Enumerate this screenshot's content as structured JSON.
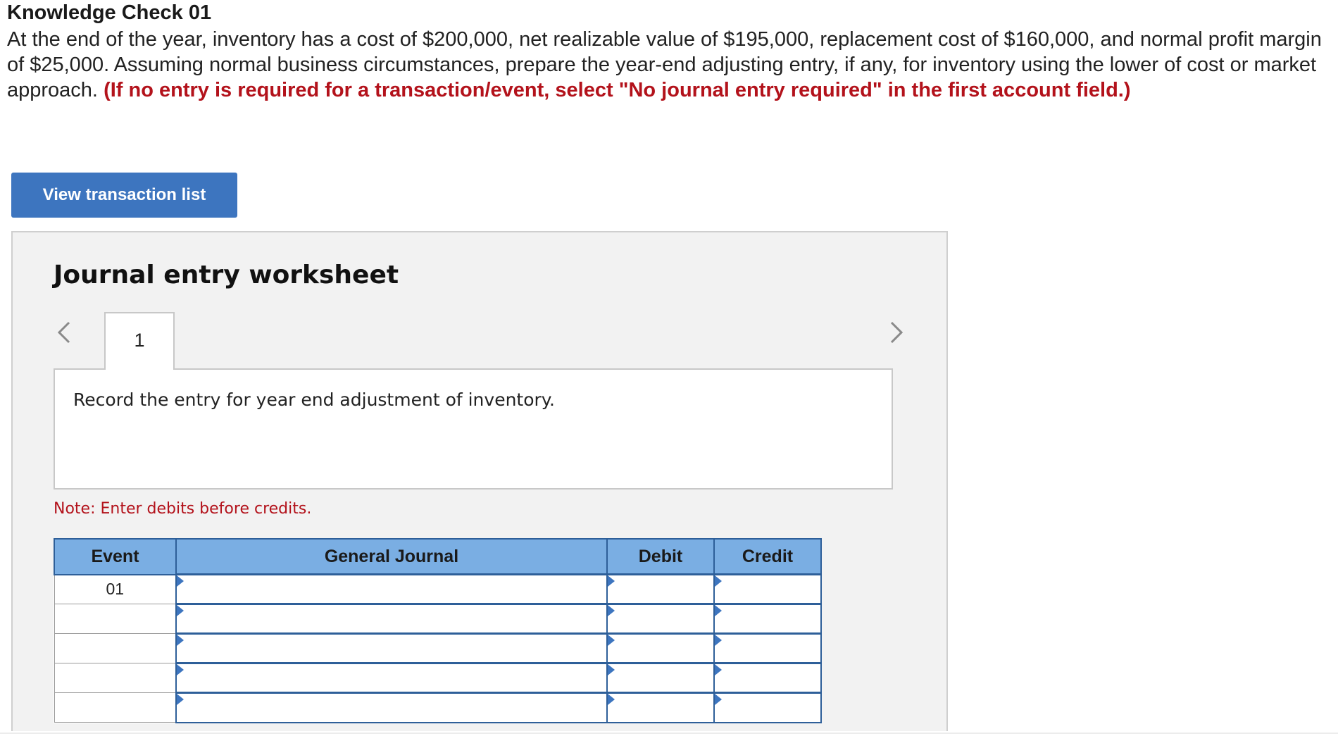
{
  "header": {
    "title": "Knowledge Check 01",
    "question": "At the end of the year, inventory has a cost of $200,000, net realizable value of $195,000, replacement cost of $160,000, and normal profit margin of $25,000. Assuming normal business circumstances, prepare the year-end adjusting entry, if any, for inventory using the lower of cost or market approach.",
    "instruction": "(If no entry is required for a transaction/event, select \"No journal entry required\" in the first account field.)"
  },
  "buttons": {
    "view_transaction_list": "View transaction list"
  },
  "worksheet": {
    "title": "Journal entry worksheet",
    "tabs": [
      "1"
    ],
    "entry_description": "Record the entry for year end adjustment of inventory.",
    "note": "Note: Enter debits before credits."
  },
  "journal": {
    "headers": {
      "event": "Event",
      "general_journal": "General Journal",
      "debit": "Debit",
      "credit": "Credit"
    },
    "rows": [
      {
        "event": "01",
        "account": "",
        "debit": "",
        "credit": ""
      },
      {
        "event": "",
        "account": "",
        "debit": "",
        "credit": ""
      },
      {
        "event": "",
        "account": "",
        "debit": "",
        "credit": ""
      },
      {
        "event": "",
        "account": "",
        "debit": "",
        "credit": ""
      },
      {
        "event": "",
        "account": "",
        "debit": "",
        "credit": ""
      }
    ]
  },
  "colors": {
    "accent_button": "#3d75bf",
    "header_fill": "#7aaee3",
    "instruction_red": "#b3121b"
  },
  "icons": {
    "prev": "chevron-left-icon",
    "next": "chevron-right-icon",
    "cell_marker": "triangle-marker-icon"
  }
}
